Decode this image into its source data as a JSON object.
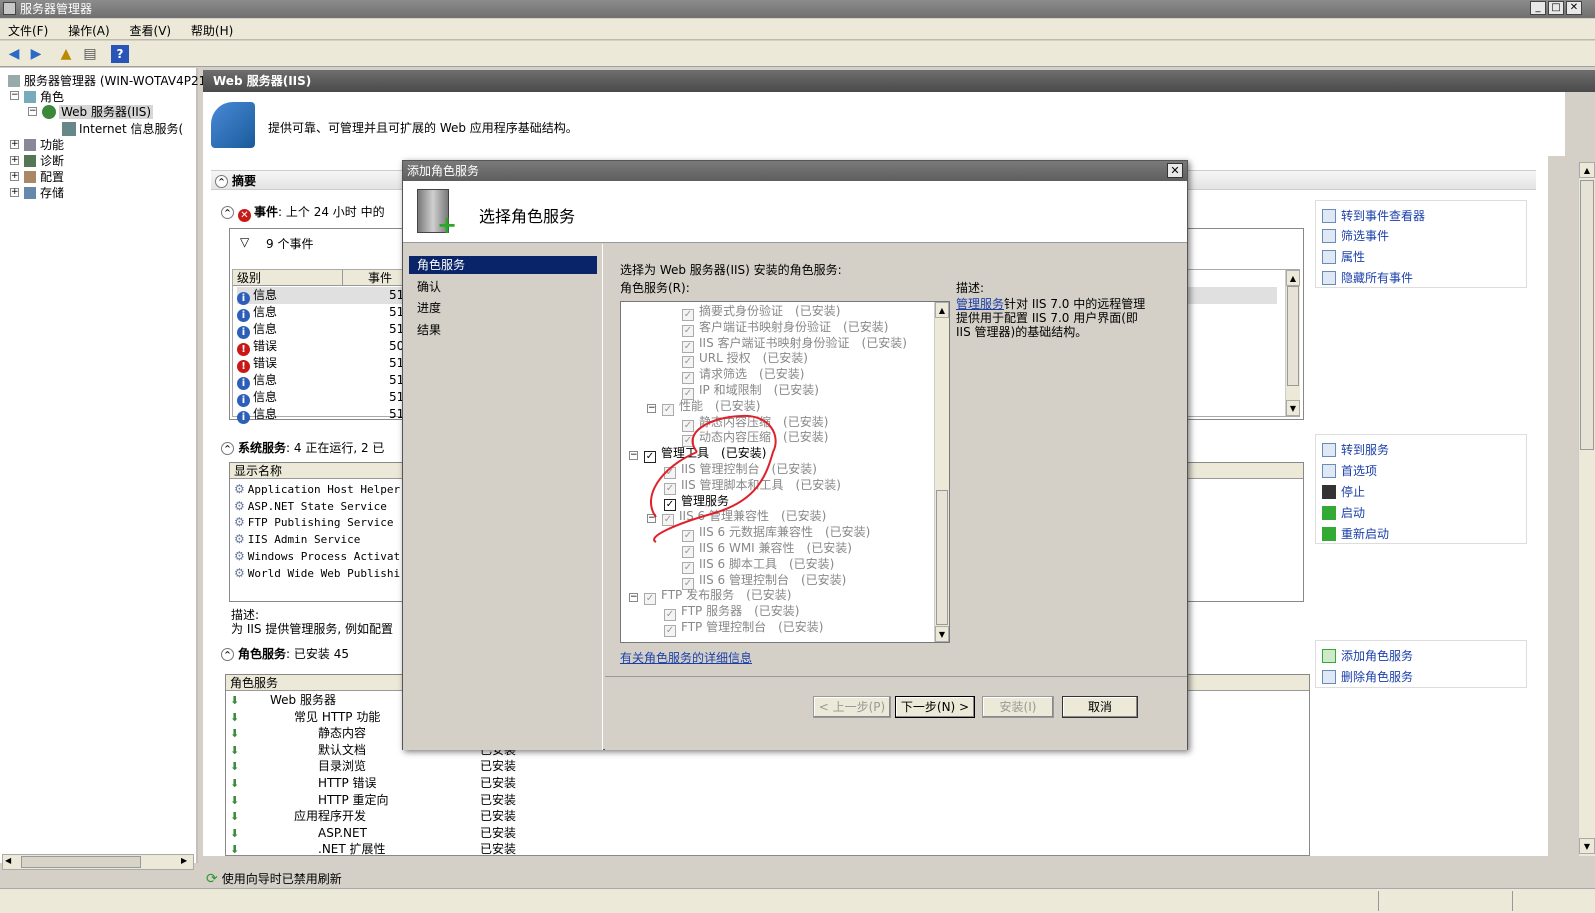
{
  "window": {
    "title": "服务器管理器"
  },
  "menu": [
    "文件(F)",
    "操作(A)",
    "查看(V)",
    "帮助(H)"
  ],
  "tree": {
    "root": "服务器管理器 (WIN-WOTAV4P21S",
    "roles": "角色",
    "web_server": "Web 服务器(IIS)",
    "iis_manager": "Internet 信息服务(",
    "features": "功能",
    "diagnostics": "诊断",
    "config": "配置",
    "storage": "存储"
  },
  "main": {
    "header": "Web 服务器(IIS)",
    "description": "提供可靠、可管理并且可扩展的 Web 应用程序基础结构。",
    "summary_title": "摘要",
    "events_title": "事件",
    "events_sub": ": 上个 24 小时 中的",
    "events_count": "9 个事件",
    "events_cols": [
      "级别",
      "事件"
    ],
    "events": [
      {
        "level": "信息",
        "type": "info",
        "id": "51"
      },
      {
        "level": "信息",
        "type": "info",
        "id": "51"
      },
      {
        "level": "信息",
        "type": "info",
        "id": "51"
      },
      {
        "level": "错误",
        "type": "err",
        "id": "50"
      },
      {
        "level": "错误",
        "type": "err",
        "id": "51"
      },
      {
        "level": "信息",
        "type": "info",
        "id": "51"
      },
      {
        "level": "信息",
        "type": "info",
        "id": "51"
      },
      {
        "level": "信息",
        "type": "info",
        "id": "51"
      }
    ],
    "events_actions": [
      "转到事件查看器",
      "筛选事件",
      "属性",
      "隐藏所有事件"
    ],
    "sys_title": "系统服务",
    "sys_sub": ": 4 正在运行, 2 已",
    "sys_col": "显示名称",
    "services": [
      "Application Host Helper...",
      "ASP.NET State Service",
      "FTP Publishing Service",
      "IIS Admin Service",
      "Windows Process Activat...",
      "World Wide Web Publishi..."
    ],
    "sys_desc_label": "描述:",
    "sys_desc": "为 IIS 提供管理服务, 例如配置",
    "sys_actions": [
      "转到服务",
      "首选项",
      "停止",
      "启动",
      "重新启动"
    ],
    "roles_title": "角色服务",
    "roles_sub": ": 已安装 45",
    "roles_col": "角色服务",
    "role_rows": [
      {
        "name": "Web 服务器",
        "status": "",
        "indent": 0
      },
      {
        "name": "常见 HTTP 功能",
        "status": "",
        "indent": 1
      },
      {
        "name": "静态内容",
        "status": "已安装",
        "indent": 2
      },
      {
        "name": "默认文档",
        "status": "已安装",
        "indent": 2
      },
      {
        "name": "目录浏览",
        "status": "已安装",
        "indent": 2
      },
      {
        "name": "HTTP 错误",
        "status": "已安装",
        "indent": 2
      },
      {
        "name": "HTTP 重定向",
        "status": "已安装",
        "indent": 2
      },
      {
        "name": "应用程序开发",
        "status": "已安装",
        "indent": 1
      },
      {
        "name": "ASP.NET",
        "status": "已安装",
        "indent": 2
      },
      {
        "name": ".NET 扩展性",
        "status": "已安装",
        "indent": 2
      }
    ],
    "roles_actions": [
      "添加角色服务",
      "删除角色服务"
    ]
  },
  "status": {
    "text": "使用向导时已禁用刷新"
  },
  "dialog": {
    "title": "添加角色服务",
    "heading": "选择角色服务",
    "nav": [
      "角色服务",
      "确认",
      "进度",
      "结果"
    ],
    "instruction": "选择为 Web 服务器(IIS) 安装的角色服务:",
    "list_label": "角色服务(R):",
    "items": [
      {
        "label": "摘要式身份验证",
        "status": "(已安装)",
        "indent": 3,
        "checked": true,
        "enabled": false,
        "toggle": ""
      },
      {
        "label": "客户端证书映射身份验证",
        "status": "(已安装)",
        "indent": 3,
        "checked": true,
        "enabled": false,
        "toggle": ""
      },
      {
        "label": "IIS 客户端证书映射身份验证",
        "status": "(已安装)",
        "indent": 3,
        "checked": true,
        "enabled": false,
        "toggle": ""
      },
      {
        "label": "URL 授权",
        "status": "(已安装)",
        "indent": 3,
        "checked": true,
        "enabled": false,
        "toggle": ""
      },
      {
        "label": "请求筛选",
        "status": "(已安装)",
        "indent": 3,
        "checked": true,
        "enabled": false,
        "toggle": ""
      },
      {
        "label": "IP 和域限制",
        "status": "(已安装)",
        "indent": 3,
        "checked": true,
        "enabled": false,
        "toggle": ""
      },
      {
        "label": "性能",
        "status": "(已安装)",
        "indent": 2,
        "checked": true,
        "enabled": false,
        "toggle": "−"
      },
      {
        "label": "静态内容压缩",
        "status": "(已安装)",
        "indent": 3,
        "checked": true,
        "enabled": false,
        "toggle": ""
      },
      {
        "label": "动态内容压缩",
        "status": "(已安装)",
        "indent": 3,
        "checked": true,
        "enabled": false,
        "toggle": ""
      },
      {
        "label": "管理工具",
        "status": "(已安装)",
        "indent": 1,
        "checked": true,
        "enabled": true,
        "toggle": "−"
      },
      {
        "label": "IIS 管理控制台",
        "status": "(已安装)",
        "indent": 2,
        "checked": true,
        "enabled": false,
        "toggle": ""
      },
      {
        "label": "IIS 管理脚本和工具",
        "status": "(已安装)",
        "indent": 2,
        "checked": true,
        "enabled": false,
        "toggle": ""
      },
      {
        "label": "管理服务",
        "status": "",
        "indent": 2,
        "checked": true,
        "enabled": true,
        "toggle": ""
      },
      {
        "label": "IIS 6 管理兼容性",
        "status": "(已安装)",
        "indent": 2,
        "checked": true,
        "enabled": false,
        "toggle": "−"
      },
      {
        "label": "IIS 6 元数据库兼容性",
        "status": "(已安装)",
        "indent": 3,
        "checked": true,
        "enabled": false,
        "toggle": ""
      },
      {
        "label": "IIS 6 WMI 兼容性",
        "status": "(已安装)",
        "indent": 3,
        "checked": true,
        "enabled": false,
        "toggle": ""
      },
      {
        "label": "IIS 6 脚本工具",
        "status": "(已安装)",
        "indent": 3,
        "checked": true,
        "enabled": false,
        "toggle": ""
      },
      {
        "label": "IIS 6 管理控制台",
        "status": "(已安装)",
        "indent": 3,
        "checked": true,
        "enabled": false,
        "toggle": ""
      },
      {
        "label": "FTP 发布服务",
        "status": "(已安装)",
        "indent": 1,
        "checked": true,
        "enabled": false,
        "toggle": "−"
      },
      {
        "label": "FTP 服务器",
        "status": "(已安装)",
        "indent": 2,
        "checked": true,
        "enabled": false,
        "toggle": ""
      },
      {
        "label": "FTP 管理控制台",
        "status": "(已安装)",
        "indent": 2,
        "checked": true,
        "enabled": false,
        "toggle": ""
      }
    ],
    "desc_label": "描述:",
    "desc_link": "管理服务",
    "desc_text": "针对 IIS 7.0 中的远程管理提供用于配置 IIS 7.0 用户界面(即 IIS 管理器)的基础结构。",
    "more_link": "有关角色服务的详细信息",
    "buttons": {
      "prev": "< 上一步(P)",
      "next": "下一步(N) >",
      "install": "安装(I)",
      "cancel": "取消"
    }
  },
  "accent": {
    "selection": "#0a246a",
    "link": "#1a3fa8",
    "annotation": "#e0202a"
  }
}
